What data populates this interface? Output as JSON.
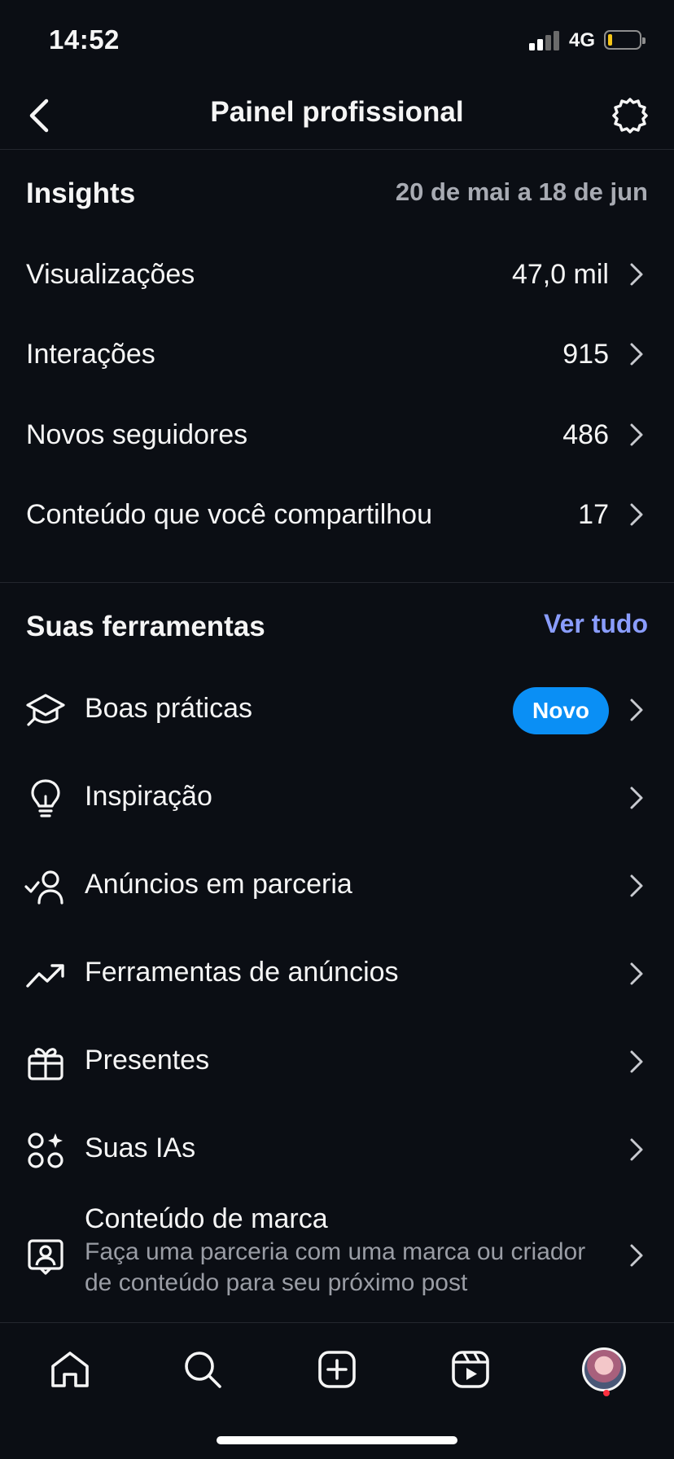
{
  "status_bar": {
    "time": "14:52",
    "network": "4G",
    "battery_level": 0.1
  },
  "header": {
    "title": "Painel profissional"
  },
  "insights": {
    "title": "Insights",
    "date_range": "20 de mai a 18 de jun",
    "metrics": [
      {
        "label": "Visualizações",
        "value": "47,0 mil"
      },
      {
        "label": "Interações",
        "value": "915"
      },
      {
        "label": "Novos seguidores",
        "value": "486"
      },
      {
        "label": "Conteúdo que você compartilhou",
        "value": "17"
      }
    ]
  },
  "tools": {
    "title": "Suas ferramentas",
    "see_all": "Ver tudo",
    "items": [
      {
        "label": "Boas práticas",
        "badge": "Novo",
        "icon": "graduation-cap-icon"
      },
      {
        "label": "Inspiração",
        "icon": "lightbulb-icon"
      },
      {
        "label": "Anúncios em parceria",
        "icon": "person-check-icon"
      },
      {
        "label": "Ferramentas de anúncios",
        "icon": "trending-up-icon"
      },
      {
        "label": "Presentes",
        "icon": "gift-icon"
      },
      {
        "label": "Suas IAs",
        "icon": "ai-sparkle-icon"
      },
      {
        "label": "Conteúdo de marca",
        "subtitle": "Faça uma parceria com uma marca ou criador de conteúdo para seu próximo post",
        "icon": "branded-content-icon"
      }
    ]
  },
  "bottom_nav": {
    "items": [
      "home-icon",
      "search-icon",
      "create-icon",
      "reels-icon",
      "profile-avatar"
    ]
  },
  "colors": {
    "background": "#0b0e14",
    "accent_link": "#8a9dff",
    "badge": "#0a8ff5",
    "notification": "#ff3040"
  }
}
